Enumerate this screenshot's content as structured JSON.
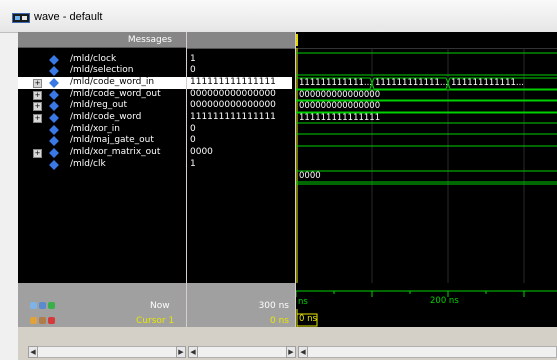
{
  "window": {
    "title": "wave - default"
  },
  "panes": {
    "messages_header": "Messages"
  },
  "signals": [
    {
      "name": "/mld/clock",
      "value": "1",
      "expandable": false
    },
    {
      "name": "/mld/selection",
      "value": "0",
      "expandable": false
    },
    {
      "name": "/mld/code_word_in",
      "value": "111111111111111",
      "expandable": true,
      "selected": true
    },
    {
      "name": "/mld/code_word_out",
      "value": "000000000000000",
      "expandable": true
    },
    {
      "name": "/mld/reg_out",
      "value": "000000000000000",
      "expandable": true
    },
    {
      "name": "/mld/code_word",
      "value": "111111111111111",
      "expandable": true
    },
    {
      "name": "/mld/xor_in",
      "value": "0",
      "expandable": false
    },
    {
      "name": "/mld/maj_gate_out",
      "value": "0",
      "expandable": false
    },
    {
      "name": "/mld/xor_matrix_out",
      "value": "0000",
      "expandable": true
    },
    {
      "name": "/mld/clk",
      "value": "1",
      "expandable": false
    }
  ],
  "wave_labels": {
    "code_word_in_a": "111111111111...",
    "code_word_in_b": "111111111111...",
    "code_word_in_c": "111111111111...",
    "code_word_out": "000000000000000",
    "reg_out": "000000000000000",
    "code_word": "111111111111111",
    "xor_matrix_out": "0000"
  },
  "status": {
    "now_label": "Now",
    "now_value": "300 ns",
    "cursor_label": "Cursor 1",
    "cursor_value": "0 ns",
    "timeline_label": "200 ns",
    "timeline_start": "ns",
    "cursor_marker": "0 ns"
  },
  "colors": {
    "wave_green": "#00d000",
    "bus_green": "#00d000",
    "selected": "#ffffff",
    "cursor": "#e8e800"
  }
}
